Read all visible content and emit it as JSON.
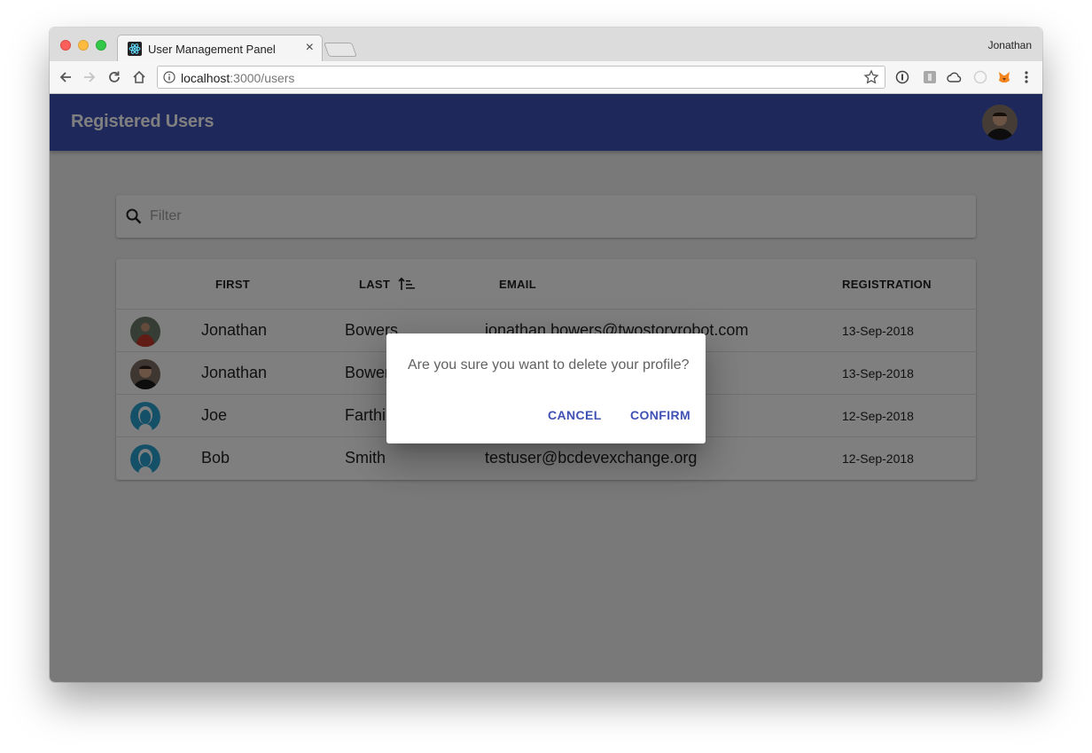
{
  "browser": {
    "tab_title": "User Management Panel",
    "tab_close": "×",
    "profile_name": "Jonathan",
    "url_host": "localhost",
    "url_path": ":3000/users"
  },
  "app": {
    "title": "Registered Users",
    "filter_placeholder": "Filter",
    "table": {
      "headers": {
        "first": "FIRST",
        "last": "LAST",
        "email": "EMAIL",
        "registration": "REGISTRATION"
      },
      "sort": {
        "column": "last",
        "direction": "ascending"
      },
      "rows": [
        {
          "avatar": "photo-red-shirt",
          "first": "Jonathan",
          "last": "Bowers",
          "email": "jonathan.bowers@twostoryrobot.com",
          "registration": "13-Sep-2018"
        },
        {
          "avatar": "photo-dark",
          "first": "Jonathan",
          "last": "Bowers",
          "email": "",
          "registration": "13-Sep-2018"
        },
        {
          "avatar": "default-user-icon",
          "first": "Joe",
          "last": "Farthi",
          "email": "",
          "registration": "12-Sep-2018"
        },
        {
          "avatar": "default-user-icon",
          "first": "Bob",
          "last": "Smith",
          "email": "testuser@bcdevexchange.org",
          "registration": "12-Sep-2018"
        }
      ]
    }
  },
  "dialog": {
    "message": "Are you sure you want to delete your profile?",
    "cancel_label": "CANCEL",
    "confirm_label": "CONFIRM"
  },
  "colors": {
    "primary": "#3f51b5",
    "backdrop": "rgba(0,0,0,0.5)",
    "avatar_default": "#29a3d1"
  }
}
